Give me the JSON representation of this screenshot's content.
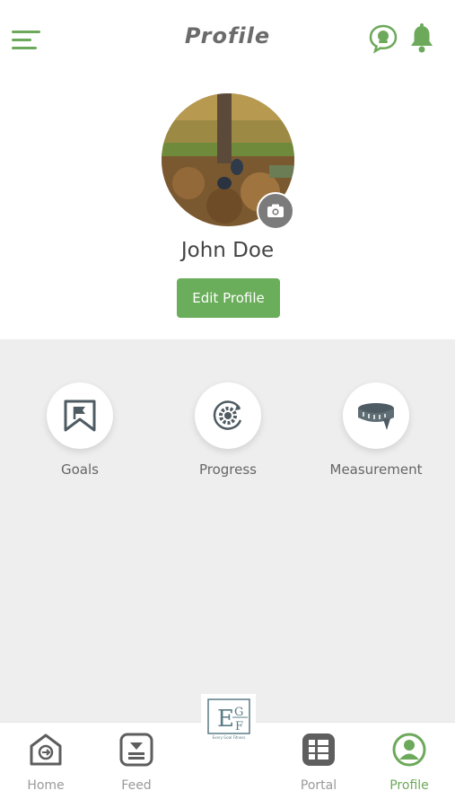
{
  "header": {
    "title": "Profile"
  },
  "profile": {
    "name": "John Doe",
    "edit_label": "Edit Profile"
  },
  "actions": [
    {
      "label": "Goals",
      "icon": "goals-flag-icon"
    },
    {
      "label": "Progress",
      "icon": "progress-gear-icon"
    },
    {
      "label": "Measurement",
      "icon": "measuring-tape-icon"
    }
  ],
  "bottom_nav": [
    {
      "label": "Home",
      "icon": "home-icon"
    },
    {
      "label": "Feed",
      "icon": "feed-icon"
    },
    {
      "label": "Portal",
      "icon": "portal-icon"
    },
    {
      "label": "Profile",
      "icon": "profile-icon",
      "active": true
    }
  ],
  "logo": {
    "letters": "EGF",
    "tagline": "Every Goal Fitness"
  },
  "colors": {
    "accent": "#6aad5a",
    "icon_dark": "#4e5b62",
    "background": "#eeeeee"
  }
}
